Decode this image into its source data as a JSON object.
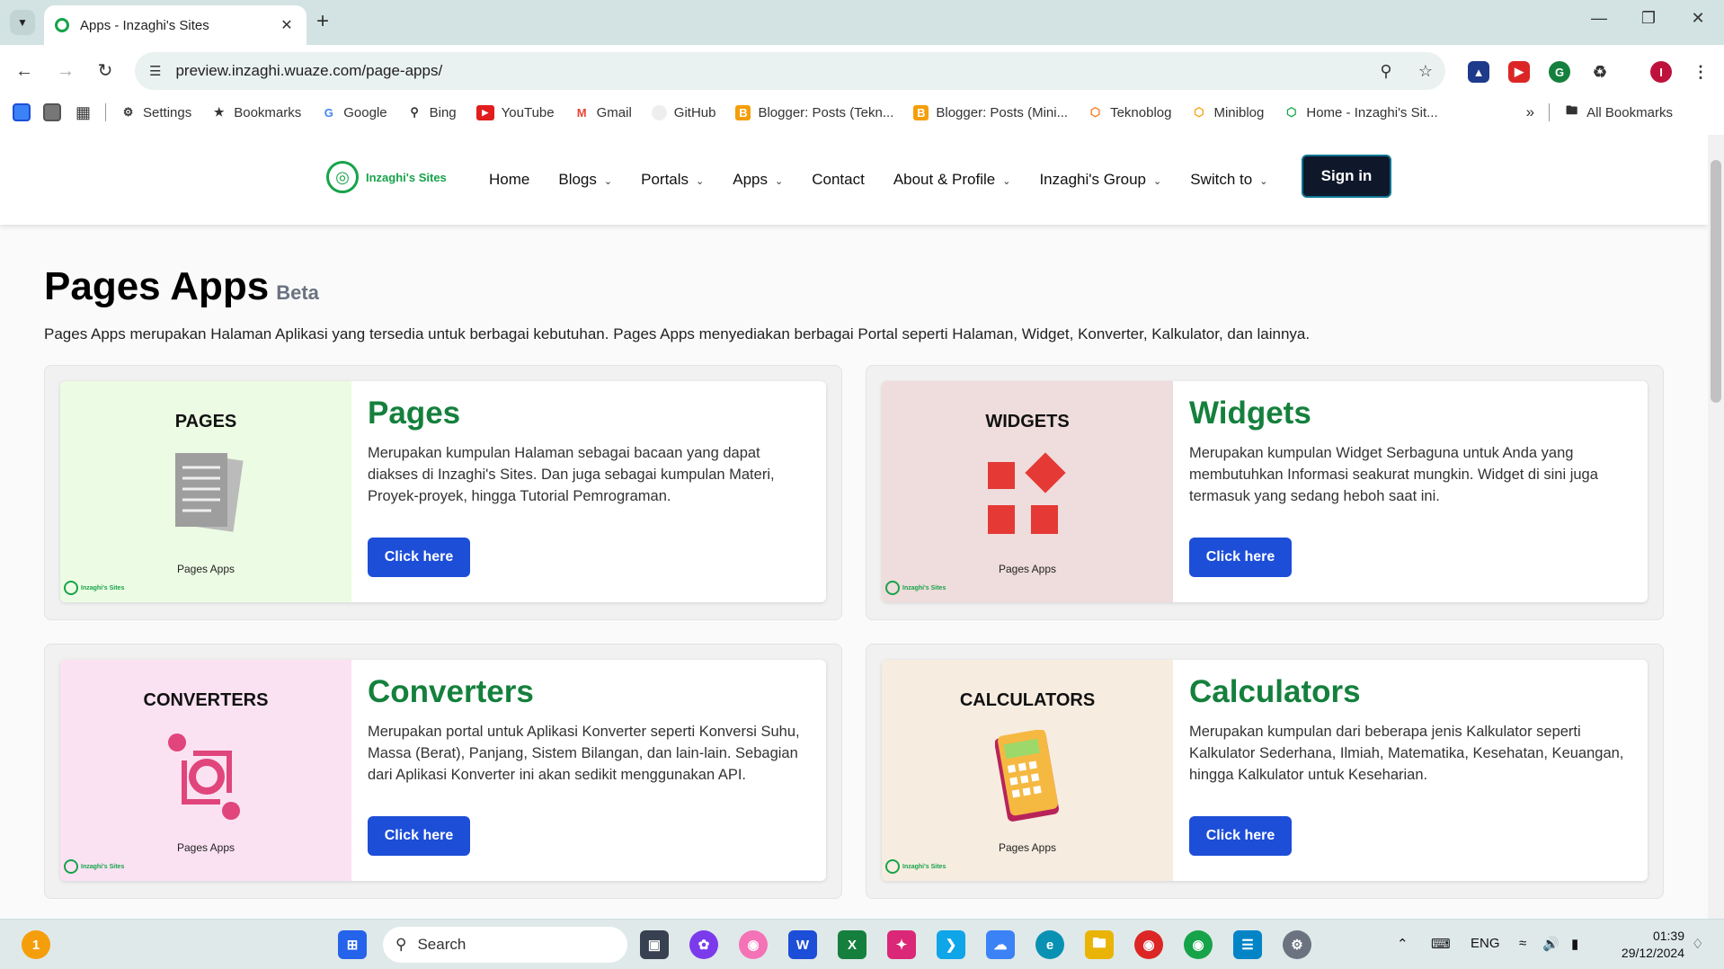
{
  "browser": {
    "tab_title": "Apps - Inzaghi's Sites",
    "url": "preview.inzaghi.wuaze.com/page-apps/",
    "profile_initial": "I"
  },
  "bookmarks": [
    {
      "label": "Settings",
      "icon": "gear-icon"
    },
    {
      "label": "Bookmarks",
      "icon": "star-icon"
    },
    {
      "label": "Google",
      "icon": "google-icon"
    },
    {
      "label": "Bing",
      "icon": "bing-icon"
    },
    {
      "label": "YouTube",
      "icon": "youtube-icon"
    },
    {
      "label": "Gmail",
      "icon": "gmail-icon"
    },
    {
      "label": "GitHub",
      "icon": "github-icon"
    },
    {
      "label": "Blogger: Posts (Tekn...",
      "icon": "blogger-icon"
    },
    {
      "label": "Blogger: Posts (Mini...",
      "icon": "blogger-icon"
    },
    {
      "label": "Teknoblog",
      "icon": "site-icon"
    },
    {
      "label": "Miniblog",
      "icon": "site-icon"
    },
    {
      "label": "Home - Inzaghi's Sit...",
      "icon": "site-icon"
    }
  ],
  "all_bookmarks": "All Bookmarks",
  "site": {
    "logo_text": "Inzaghi's Sites",
    "menu": [
      "Home",
      "Blogs",
      "Portals",
      "Apps",
      "Contact",
      "About & Profile",
      "Inzaghi's Group",
      "Switch to"
    ],
    "menu_dropdown": [
      false,
      true,
      true,
      true,
      false,
      true,
      true,
      true
    ],
    "signin": "Sign in"
  },
  "page": {
    "title": "Pages Apps",
    "badge": "Beta",
    "intro": "Pages Apps merupakan Halaman Aplikasi yang tersedia untuk berbagai kebutuhan. Pages Apps menyediakan berbagai Portal seperti Halaman, Widget, Konverter, Kalkulator, dan lainnya."
  },
  "cards": [
    {
      "thumb_title": "PAGES",
      "thumb_sub": "Pages Apps",
      "title": "Pages",
      "desc": "Merupakan kumpulan Halaman sebagai bacaan yang dapat diakses di Inzaghi's Sites. Dan juga sebagai kumpulan Materi, Proyek-proyek, hingga Tutorial Pemrograman.",
      "button": "Click here",
      "bg": "#ecfbe3"
    },
    {
      "thumb_title": "WIDGETS",
      "thumb_sub": "Pages Apps",
      "title": "Widgets",
      "desc": "Merupakan kumpulan Widget Serbaguna untuk Anda yang membutuhkan Informasi seakurat mungkin. Widget di sini juga termasuk yang sedang heboh saat ini.",
      "button": "Click here",
      "bg": "#efdcdc"
    },
    {
      "thumb_title": "CONVERTERS",
      "thumb_sub": "Pages Apps",
      "title": "Converters",
      "desc": "Merupakan portal untuk Aplikasi Konverter seperti Konversi Suhu, Massa (Berat), Panjang, Sistem Bilangan, dan lain-lain. Sebagian dari Aplikasi Konverter ini akan sedikit menggunakan API.",
      "button": "Click here",
      "bg": "#fbe2f3"
    },
    {
      "thumb_title": "CALCULATORS",
      "thumb_sub": "Pages Apps",
      "title": "Calculators",
      "desc": "Merupakan kumpulan dari beberapa jenis Kalkulator seperti Kalkulator Sederhana, Ilmiah, Matematika, Kesehatan, Keuangan, hingga Kalkulator untuk Keseharian.",
      "button": "Click here",
      "bg": "#f7ece0"
    }
  ],
  "mini_logo": "Inzaghi's Sites",
  "taskbar": {
    "search_placeholder": "Search",
    "lang": "ENG",
    "time": "01:39",
    "date": "29/12/2024",
    "weather_badge": "1"
  }
}
